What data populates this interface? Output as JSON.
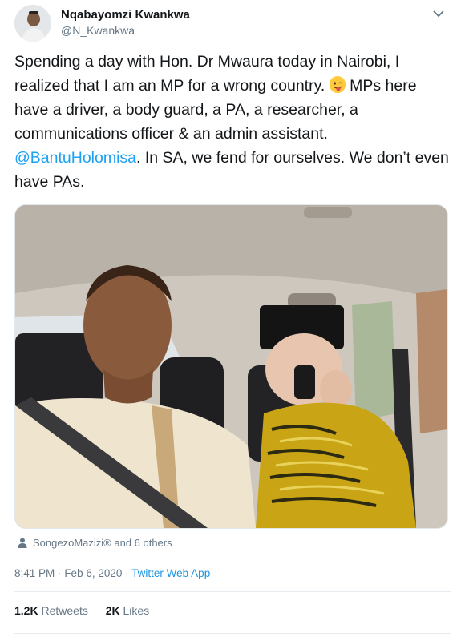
{
  "tweet": {
    "author": {
      "display_name": "Nqabayomzi Kwankwa",
      "handle": "@N_Kwankwa"
    },
    "text": {
      "part1": "Spending a day with Hon. Dr Mwaura today in Nairobi, I realized that I am an MP for a wrong country. ",
      "emoji_icon": "winking-face-with-tongue-emoji",
      "part2": " MPs here have a driver, a body guard, a PA, a researcher, a communications officer & an admin assistant. ",
      "mention": "@BantuHolomisa",
      "part3": ". In SA, we fend for ourselves. We don’t even have PAs."
    },
    "tagged_people": "SongezoMazizi® and 6 others",
    "time": "8:41 PM",
    "date": "Feb 6, 2020",
    "separator": "·",
    "client": "Twitter Web App",
    "stats": {
      "retweets_count": "1.2K",
      "retweets_label": "Retweets",
      "likes_count": "2K",
      "likes_label": "Likes"
    }
  },
  "colors": {
    "link_blue": "#1da1f2",
    "secondary_text": "#657786",
    "primary_text": "#14171a"
  }
}
